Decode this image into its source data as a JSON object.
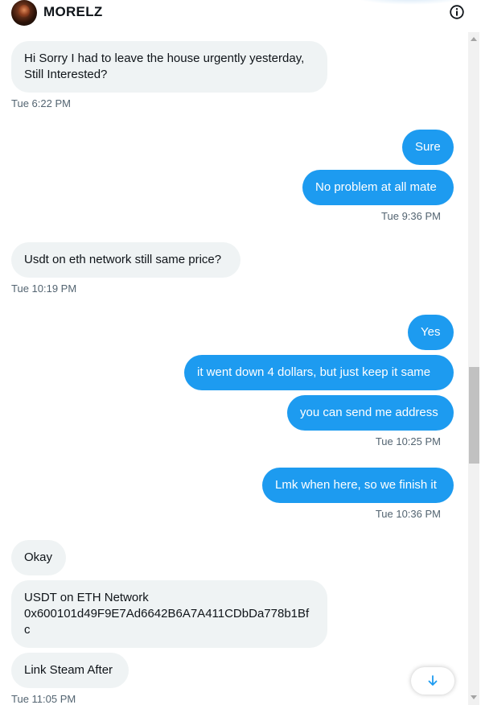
{
  "header": {
    "title": "MORELZ",
    "icons": [
      "avatar",
      "info-icon"
    ]
  },
  "messages": [
    {
      "dir": "in",
      "text": "Hi Sorry I had to leave the house urgently yesterday,\nStill Interested?"
    },
    {
      "dir": "ts-in",
      "text": "Tue 6:22 PM"
    },
    {
      "dir": "out",
      "text": "Sure"
    },
    {
      "dir": "out",
      "text": "No problem at all mate"
    },
    {
      "dir": "ts-out",
      "text": "Tue 9:36 PM"
    },
    {
      "dir": "in",
      "text": "Usdt on eth network still same price?"
    },
    {
      "dir": "ts-in",
      "text": "Tue 10:19 PM"
    },
    {
      "dir": "out",
      "text": "Yes"
    },
    {
      "dir": "out",
      "text": "it went down 4 dollars, but just keep it same"
    },
    {
      "dir": "out",
      "text": "you can send me address"
    },
    {
      "dir": "ts-out",
      "text": "Tue 10:25 PM"
    },
    {
      "dir": "out",
      "text": "Lmk when here, so we finish it"
    },
    {
      "dir": "ts-out",
      "text": "Tue 10:36 PM"
    },
    {
      "dir": "in",
      "text": "Okay"
    },
    {
      "dir": "in",
      "text": "USDT on ETH Network\n0x600101d49F9E7Ad6642B6A7A411CDbDa778b1Bf\nc"
    },
    {
      "dir": "in",
      "text": "Link Steam After"
    },
    {
      "dir": "ts-in",
      "text": "Tue 11:05 PM"
    }
  ],
  "jump_button": {
    "icon": "arrow-down-icon"
  },
  "colors": {
    "accent": "#1d9bf0",
    "incoming_bg": "#eff3f4",
    "timestamp": "#536471"
  }
}
